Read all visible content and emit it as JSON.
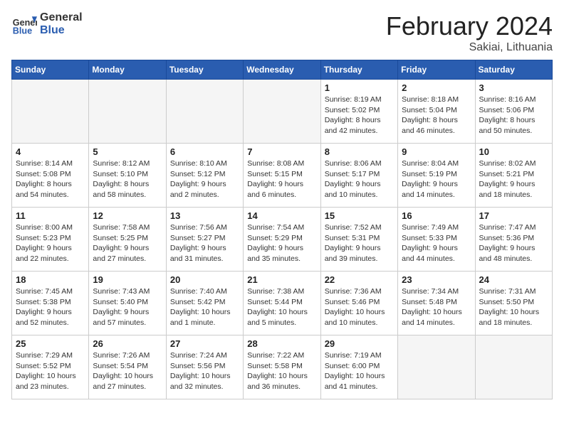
{
  "header": {
    "logo_general": "General",
    "logo_blue": "Blue",
    "month_title": "February 2024",
    "location": "Sakiai, Lithuania"
  },
  "weekdays": [
    "Sunday",
    "Monday",
    "Tuesday",
    "Wednesday",
    "Thursday",
    "Friday",
    "Saturday"
  ],
  "weeks": [
    [
      {
        "day": "",
        "info": ""
      },
      {
        "day": "",
        "info": ""
      },
      {
        "day": "",
        "info": ""
      },
      {
        "day": "",
        "info": ""
      },
      {
        "day": "1",
        "info": "Sunrise: 8:19 AM\nSunset: 5:02 PM\nDaylight: 8 hours\nand 42 minutes."
      },
      {
        "day": "2",
        "info": "Sunrise: 8:18 AM\nSunset: 5:04 PM\nDaylight: 8 hours\nand 46 minutes."
      },
      {
        "day": "3",
        "info": "Sunrise: 8:16 AM\nSunset: 5:06 PM\nDaylight: 8 hours\nand 50 minutes."
      }
    ],
    [
      {
        "day": "4",
        "info": "Sunrise: 8:14 AM\nSunset: 5:08 PM\nDaylight: 8 hours\nand 54 minutes."
      },
      {
        "day": "5",
        "info": "Sunrise: 8:12 AM\nSunset: 5:10 PM\nDaylight: 8 hours\nand 58 minutes."
      },
      {
        "day": "6",
        "info": "Sunrise: 8:10 AM\nSunset: 5:12 PM\nDaylight: 9 hours\nand 2 minutes."
      },
      {
        "day": "7",
        "info": "Sunrise: 8:08 AM\nSunset: 5:15 PM\nDaylight: 9 hours\nand 6 minutes."
      },
      {
        "day": "8",
        "info": "Sunrise: 8:06 AM\nSunset: 5:17 PM\nDaylight: 9 hours\nand 10 minutes."
      },
      {
        "day": "9",
        "info": "Sunrise: 8:04 AM\nSunset: 5:19 PM\nDaylight: 9 hours\nand 14 minutes."
      },
      {
        "day": "10",
        "info": "Sunrise: 8:02 AM\nSunset: 5:21 PM\nDaylight: 9 hours\nand 18 minutes."
      }
    ],
    [
      {
        "day": "11",
        "info": "Sunrise: 8:00 AM\nSunset: 5:23 PM\nDaylight: 9 hours\nand 22 minutes."
      },
      {
        "day": "12",
        "info": "Sunrise: 7:58 AM\nSunset: 5:25 PM\nDaylight: 9 hours\nand 27 minutes."
      },
      {
        "day": "13",
        "info": "Sunrise: 7:56 AM\nSunset: 5:27 PM\nDaylight: 9 hours\nand 31 minutes."
      },
      {
        "day": "14",
        "info": "Sunrise: 7:54 AM\nSunset: 5:29 PM\nDaylight: 9 hours\nand 35 minutes."
      },
      {
        "day": "15",
        "info": "Sunrise: 7:52 AM\nSunset: 5:31 PM\nDaylight: 9 hours\nand 39 minutes."
      },
      {
        "day": "16",
        "info": "Sunrise: 7:49 AM\nSunset: 5:33 PM\nDaylight: 9 hours\nand 44 minutes."
      },
      {
        "day": "17",
        "info": "Sunrise: 7:47 AM\nSunset: 5:36 PM\nDaylight: 9 hours\nand 48 minutes."
      }
    ],
    [
      {
        "day": "18",
        "info": "Sunrise: 7:45 AM\nSunset: 5:38 PM\nDaylight: 9 hours\nand 52 minutes."
      },
      {
        "day": "19",
        "info": "Sunrise: 7:43 AM\nSunset: 5:40 PM\nDaylight: 9 hours\nand 57 minutes."
      },
      {
        "day": "20",
        "info": "Sunrise: 7:40 AM\nSunset: 5:42 PM\nDaylight: 10 hours\nand 1 minute."
      },
      {
        "day": "21",
        "info": "Sunrise: 7:38 AM\nSunset: 5:44 PM\nDaylight: 10 hours\nand 5 minutes."
      },
      {
        "day": "22",
        "info": "Sunrise: 7:36 AM\nSunset: 5:46 PM\nDaylight: 10 hours\nand 10 minutes."
      },
      {
        "day": "23",
        "info": "Sunrise: 7:34 AM\nSunset: 5:48 PM\nDaylight: 10 hours\nand 14 minutes."
      },
      {
        "day": "24",
        "info": "Sunrise: 7:31 AM\nSunset: 5:50 PM\nDaylight: 10 hours\nand 18 minutes."
      }
    ],
    [
      {
        "day": "25",
        "info": "Sunrise: 7:29 AM\nSunset: 5:52 PM\nDaylight: 10 hours\nand 23 minutes."
      },
      {
        "day": "26",
        "info": "Sunrise: 7:26 AM\nSunset: 5:54 PM\nDaylight: 10 hours\nand 27 minutes."
      },
      {
        "day": "27",
        "info": "Sunrise: 7:24 AM\nSunset: 5:56 PM\nDaylight: 10 hours\nand 32 minutes."
      },
      {
        "day": "28",
        "info": "Sunrise: 7:22 AM\nSunset: 5:58 PM\nDaylight: 10 hours\nand 36 minutes."
      },
      {
        "day": "29",
        "info": "Sunrise: 7:19 AM\nSunset: 6:00 PM\nDaylight: 10 hours\nand 41 minutes."
      },
      {
        "day": "",
        "info": ""
      },
      {
        "day": "",
        "info": ""
      }
    ]
  ]
}
